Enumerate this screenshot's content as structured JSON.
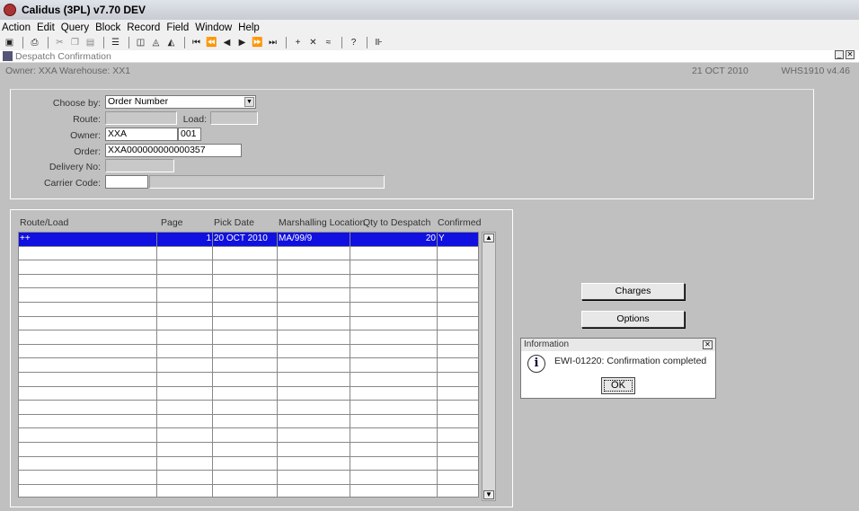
{
  "app": {
    "title": "Calidus (3PL) v7.70 DEV"
  },
  "menu": [
    "Action",
    "Edit",
    "Query",
    "Block",
    "Record",
    "Field",
    "Window",
    "Help"
  ],
  "form": {
    "title": "Despatch Confirmation",
    "owner_label": "Owner: XXA  Warehouse: XX1",
    "date": "21 OCT 2010",
    "version": "WHS1910  v4.46"
  },
  "header": {
    "choose_by_label": "Choose by:",
    "choose_by_value": "Order Number",
    "route_label": "Route:",
    "route_value": "",
    "load_label": "Load:",
    "load_value": "",
    "owner_label": "Owner:",
    "owner_value": "XXA",
    "owner_code": "001",
    "order_label": "Order:",
    "order_value": "XXA000000000000357",
    "delivery_label": "Delivery No:",
    "delivery_value": "",
    "carrier_label": "Carrier Code:",
    "carrier_value": "",
    "carrier_desc": ""
  },
  "grid": {
    "columns": [
      "Route/Load",
      "Page",
      "Pick Date",
      "Marshalling Location",
      "Qty to Despatch",
      "Confirmed"
    ],
    "rows": [
      [
        "++",
        "1",
        "20 OCT 2010",
        "MA/99/9",
        "20",
        "Y"
      ]
    ]
  },
  "buttons": {
    "charges": "Charges",
    "options": "Options"
  },
  "dialog": {
    "title": "Information",
    "message": "EWI-01220: Confirmation completed",
    "ok": "OK"
  }
}
